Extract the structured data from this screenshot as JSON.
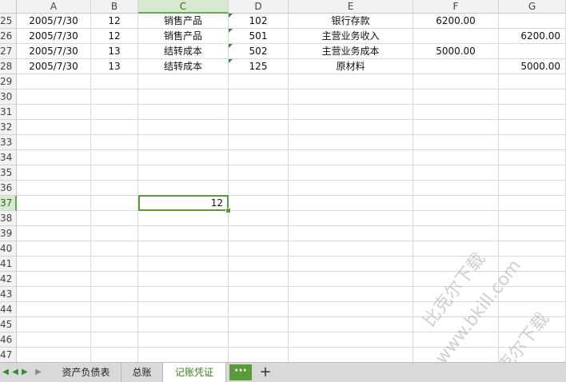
{
  "columns": [
    "A",
    "B",
    "C",
    "D",
    "E",
    "F",
    "G"
  ],
  "active_column": "C",
  "rows": [
    {
      "num": "25",
      "cells": [
        "2005/7/30",
        "12",
        "销售产品",
        "102",
        "银行存款",
        "6200.00",
        ""
      ],
      "flags": [
        false,
        false,
        false,
        true,
        false,
        false,
        false
      ]
    },
    {
      "num": "26",
      "cells": [
        "2005/7/30",
        "12",
        "销售产品",
        "501",
        "主营业务收入",
        "",
        "6200.00"
      ],
      "flags": [
        false,
        false,
        false,
        true,
        false,
        false,
        false
      ]
    },
    {
      "num": "27",
      "cells": [
        "2005/7/30",
        "13",
        "结转成本",
        "502",
        "主营业务成本",
        "5000.00",
        ""
      ],
      "flags": [
        false,
        false,
        false,
        true,
        false,
        false,
        false
      ]
    },
    {
      "num": "28",
      "cells": [
        "2005/7/30",
        "13",
        "结转成本",
        "125",
        "原材料",
        "",
        "5000.00"
      ],
      "flags": [
        false,
        false,
        false,
        true,
        false,
        false,
        false
      ]
    },
    {
      "num": "29",
      "cells": [
        "",
        "",
        "",
        "",
        "",
        "",
        ""
      ]
    },
    {
      "num": "30",
      "cells": [
        "",
        "",
        "",
        "",
        "",
        "",
        ""
      ]
    },
    {
      "num": "31",
      "cells": [
        "",
        "",
        "",
        "",
        "",
        "",
        ""
      ]
    },
    {
      "num": "32",
      "cells": [
        "",
        "",
        "",
        "",
        "",
        "",
        ""
      ]
    },
    {
      "num": "33",
      "cells": [
        "",
        "",
        "",
        "",
        "",
        "",
        ""
      ]
    },
    {
      "num": "34",
      "cells": [
        "",
        "",
        "",
        "",
        "",
        "",
        ""
      ]
    },
    {
      "num": "35",
      "cells": [
        "",
        "",
        "",
        "",
        "",
        "",
        ""
      ]
    },
    {
      "num": "36",
      "cells": [
        "",
        "",
        "",
        "",
        "",
        "",
        ""
      ]
    },
    {
      "num": "37",
      "cells": [
        "",
        "",
        "12",
        "",
        "",
        "",
        ""
      ]
    },
    {
      "num": "38",
      "cells": [
        "",
        "",
        "",
        "",
        "",
        "",
        ""
      ]
    },
    {
      "num": "39",
      "cells": [
        "",
        "",
        "",
        "",
        "",
        "",
        ""
      ]
    },
    {
      "num": "40",
      "cells": [
        "",
        "",
        "",
        "",
        "",
        "",
        ""
      ]
    },
    {
      "num": "41",
      "cells": [
        "",
        "",
        "",
        "",
        "",
        "",
        ""
      ]
    },
    {
      "num": "42",
      "cells": [
        "",
        "",
        "",
        "",
        "",
        "",
        ""
      ]
    },
    {
      "num": "43",
      "cells": [
        "",
        "",
        "",
        "",
        "",
        "",
        ""
      ]
    },
    {
      "num": "44",
      "cells": [
        "",
        "",
        "",
        "",
        "",
        "",
        ""
      ]
    },
    {
      "num": "45",
      "cells": [
        "",
        "",
        "",
        "",
        "",
        "",
        ""
      ]
    },
    {
      "num": "46",
      "cells": [
        "",
        "",
        "",
        "",
        "",
        "",
        ""
      ]
    },
    {
      "num": "47",
      "cells": [
        "",
        "",
        "",
        "",
        "",
        "",
        ""
      ]
    }
  ],
  "active_cell": {
    "row": "37",
    "col": "C",
    "value": "12"
  },
  "sheet_tabs": [
    {
      "label": "资产负债表",
      "active": false
    },
    {
      "label": "总账",
      "active": false
    },
    {
      "label": "记账凭证",
      "active": true
    }
  ],
  "tab_nav": {
    "first": "◀",
    "prev": "◀",
    "next": "▶",
    "last": "▶"
  },
  "more_tabs_label": "···",
  "add_sheet_label": "+",
  "watermark": {
    "line1": "比克尔下载",
    "line2": "www.bkill.com",
    "line3": "比克尔下载"
  },
  "colors": {
    "accent": "#5b9a3a",
    "header_bg": "#f2f2f2",
    "active_header_bg": "#d7e9cf",
    "tabbar_bg": "#d9d9d9"
  }
}
